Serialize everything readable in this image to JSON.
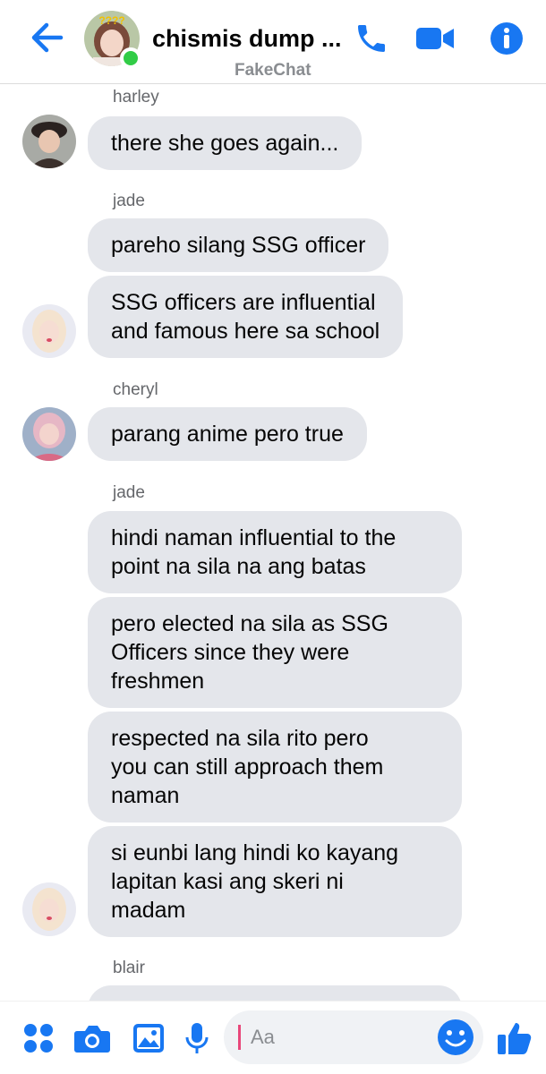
{
  "header": {
    "title": "chismis dump ...",
    "subtitle": "FakeChat",
    "group_avatar_label": "????",
    "accent": "#1877f2",
    "online_color": "#31cc46"
  },
  "messages": {
    "harley": {
      "name": "harley",
      "texts": [
        "there she goes again..."
      ]
    },
    "jade1": {
      "name": "jade",
      "texts": [
        "pareho silang SSG officer",
        "SSG officers are influential\nand famous here sa school"
      ]
    },
    "cheryl": {
      "name": "cheryl",
      "texts": [
        "parang anime pero true"
      ]
    },
    "jade2": {
      "name": "jade",
      "texts": [
        "hindi naman influential to the\npoint na sila na ang batas",
        "pero elected na sila as SSG\nOfficers since they were\nfreshmen",
        "respected na sila rito pero\nyou can still approach them\nnaman",
        "si eunbi lang hindi ko kayang\nlapitan kasi ang skeri ni\nmadam"
      ]
    },
    "blair": {
      "name": "blair",
      "texts": []
    }
  },
  "composer": {
    "placeholder": "Aa"
  },
  "icons": {
    "back": "arrow-left-icon",
    "call": "phone-icon",
    "video": "video-camera-icon",
    "info": "info-icon",
    "menu": "four-dots-icon",
    "camera": "camera-icon",
    "gallery": "image-icon",
    "mic": "microphone-icon",
    "emoji": "smiley-icon",
    "like": "thumbs-up-icon"
  }
}
